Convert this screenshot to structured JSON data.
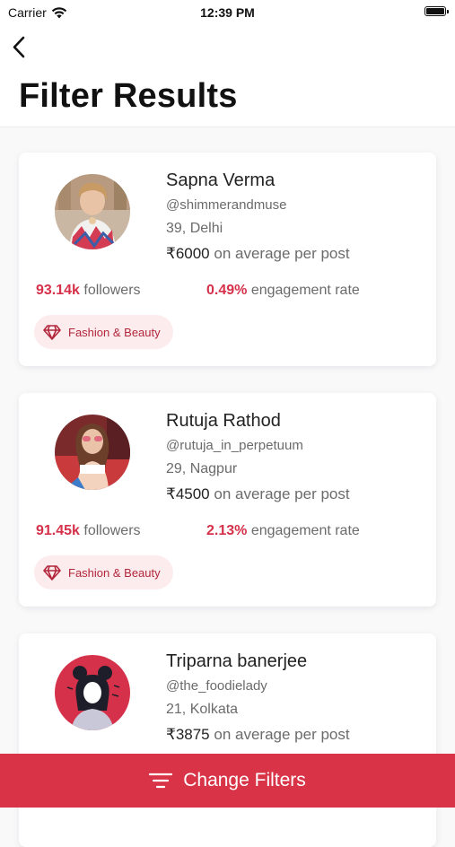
{
  "status": {
    "carrier": "Carrier",
    "time": "12:39 PM"
  },
  "header": {
    "title": "Filter Results"
  },
  "results": [
    {
      "name": "Sapna Verma",
      "handle": "@shimmerandmuse",
      "location": "39, Delhi",
      "price_amount": "₹6000",
      "price_suffix": " on average per post",
      "followers_value": "93.14k",
      "followers_label": " followers",
      "engagement_value": "0.49%",
      "engagement_label": " engagement rate",
      "category": "Fashion & Beauty"
    },
    {
      "name": "Rutuja Rathod",
      "handle": "@rutuja_in_perpetuum",
      "location": "29, Nagpur",
      "price_amount": "₹4500",
      "price_suffix": " on average per post",
      "followers_value": "91.45k",
      "followers_label": " followers",
      "engagement_value": "2.13%",
      "engagement_label": " engagement rate",
      "category": "Fashion & Beauty"
    },
    {
      "name": "Triparna banerjee",
      "handle": "@the_foodielady",
      "location": "21, Kolkata",
      "price_amount": "₹3875",
      "price_suffix": " on average per post"
    }
  ],
  "footer": {
    "button_label": "Change Filters"
  },
  "colors": {
    "accent": "#d93347",
    "highlight": "#d6314a",
    "tag_bg": "#fdecee"
  },
  "icons": {
    "back": "chevron-left-icon",
    "wifi": "wifi-icon",
    "battery": "battery-icon",
    "tag": "diamond-icon",
    "filter": "filter-lines-icon"
  }
}
